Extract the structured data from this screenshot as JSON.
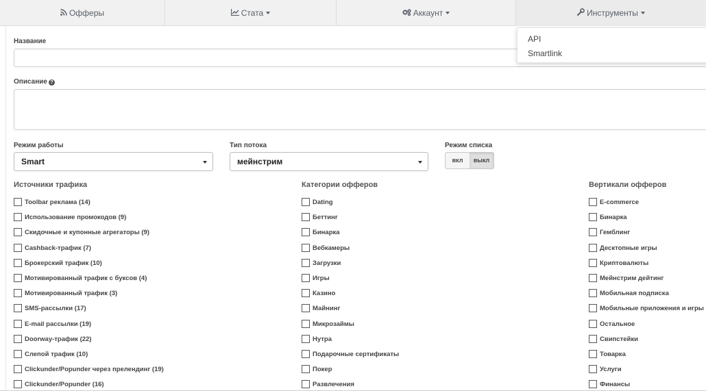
{
  "nav": {
    "offers": "Офферы",
    "stats": "Стата",
    "account": "Аккаунт",
    "tools": "Инструменты"
  },
  "tools_menu": [
    "API",
    "Smartlink"
  ],
  "form": {
    "name_label": "Название",
    "name_value": "",
    "description_label": "Описание",
    "description_value": "",
    "mode_label": "Режим работы",
    "mode_value": "Smart",
    "flow_label": "Тип потока",
    "flow_value": "мейнстрим",
    "list_label": "Режим списка",
    "list_on": "вкл",
    "list_off": "выкл"
  },
  "traffic_sources": {
    "title": "Источники трафика",
    "items": [
      "Toolbar реклама (14)",
      "Использование промокодов (9)",
      "Скидочные и купонные агрегаторы (9)",
      "Cashback-трафик (7)",
      "Брокерский трафик (10)",
      "Мотивированный трафик с буксов (4)",
      "Мотивированный трафик (3)",
      "SMS-рассылки (17)",
      "E-mail рассылки (19)",
      "Doorway-трафик (22)",
      "Слепой трафик (10)",
      "Clickunder/Popunder через прелендинг (19)",
      "Clickunder/Popunder (16)"
    ]
  },
  "offer_categories": {
    "title": "Категории офферов",
    "items": [
      "Dating",
      "Беттинг",
      "Бинарка",
      "Вебкамеры",
      "Загрузки",
      "Игры",
      "Казино",
      "Майнинг",
      "Микрозаймы",
      "Нутра",
      "Подарочные сертификаты",
      "Покер",
      "Развлечения"
    ]
  },
  "offer_verticals": {
    "title": "Вертикали офферов",
    "items": [
      "E-commerce",
      "Бинарка",
      "Гемблинг",
      "Десктопные игры",
      "Криптовалюты",
      "Мейнстрим дейтинг",
      "Мобильная подписка",
      "Мобильные приложения и игры",
      "Остальное",
      "Свипстейки",
      "Товарка",
      "Услуги",
      "Финансы"
    ]
  },
  "icons": {
    "offers": "rss-icon",
    "stats": "line-chart-icon",
    "account": "gears-icon",
    "tools": "wrench-icon",
    "help": "question-circle-icon"
  }
}
